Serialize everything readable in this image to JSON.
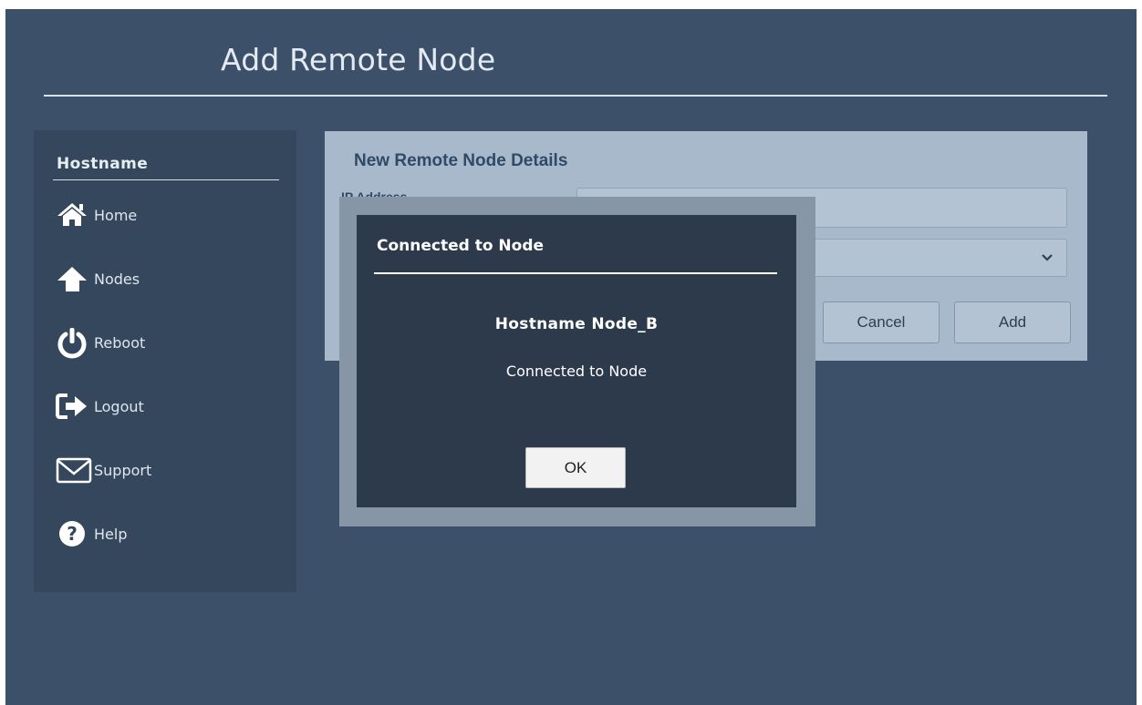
{
  "page": {
    "title": "Add Remote Node"
  },
  "sidebar": {
    "header": "Hostname",
    "items": [
      {
        "label": "Home",
        "icon": "home-icon"
      },
      {
        "label": "Nodes",
        "icon": "up-arrow-icon"
      },
      {
        "label": "Reboot",
        "icon": "power-icon"
      },
      {
        "label": "Logout",
        "icon": "logout-icon"
      },
      {
        "label": "Support",
        "icon": "envelope-icon"
      },
      {
        "label": "Help",
        "icon": "help-icon"
      }
    ]
  },
  "form": {
    "heading": "New Remote Node Details",
    "ip_label": "IP Address",
    "ip_value": "",
    "select_value": "",
    "cancel_label": "Cancel",
    "add_label": "Add"
  },
  "modal": {
    "title": "Connected to Node",
    "hostname": "Hostname Node_B",
    "message": "Connected to Node",
    "ok_label": "OK"
  },
  "colors": {
    "background": "#3c5069",
    "sidebar": "#34475d",
    "panel": "#a8b9cb",
    "modal": "#2d3a4c",
    "modal_frame": "#8796a6"
  }
}
